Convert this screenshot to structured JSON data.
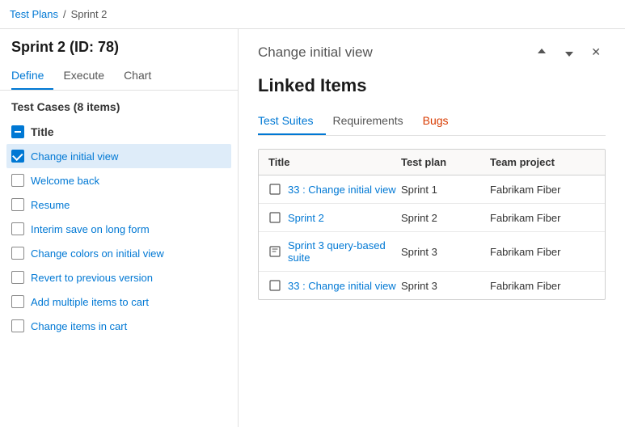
{
  "breadcrumb": {
    "part1": "Test Plans",
    "separator": "/",
    "part2": "Sprint 2"
  },
  "left": {
    "sprint_title": "Sprint 2 (ID: 78)",
    "tabs": [
      {
        "label": "Define",
        "active": true
      },
      {
        "label": "Execute",
        "active": false
      },
      {
        "label": "Chart",
        "active": false
      }
    ],
    "test_cases_header": "Test Cases (8 items)",
    "items": [
      {
        "text": "Title",
        "type": "header"
      },
      {
        "text": "Change initial view",
        "type": "checked",
        "selected": true
      },
      {
        "text": "Welcome back",
        "type": "unchecked",
        "selected": false
      },
      {
        "text": "Resume",
        "type": "unchecked",
        "selected": false
      },
      {
        "text": "Interim save on long form",
        "type": "unchecked",
        "selected": false
      },
      {
        "text": "Change colors on initial view",
        "type": "unchecked",
        "selected": false
      },
      {
        "text": "Revert to previous version",
        "type": "unchecked",
        "selected": false
      },
      {
        "text": "Add multiple items to cart",
        "type": "unchecked",
        "selected": false
      },
      {
        "text": "Change items in cart",
        "type": "unchecked",
        "selected": false
      }
    ]
  },
  "right": {
    "panel_title": "Change initial view",
    "linked_items_heading": "Linked Items",
    "tabs": [
      {
        "label": "Test Suites",
        "active": true,
        "color": "blue"
      },
      {
        "label": "Requirements",
        "active": false,
        "color": "normal"
      },
      {
        "label": "Bugs",
        "active": false,
        "color": "orange"
      }
    ],
    "table": {
      "columns": [
        "Title",
        "Test plan",
        "Team project"
      ],
      "rows": [
        {
          "icon": "static-suite",
          "title": "33 : Change initial view",
          "test_plan": "Sprint 1",
          "team_project": "Fabrikam Fiber"
        },
        {
          "icon": "static-suite",
          "title": "Sprint 2",
          "test_plan": "Sprint 2",
          "team_project": "Fabrikam Fiber"
        },
        {
          "icon": "query-suite",
          "title": "Sprint 3 query-based suite",
          "test_plan": "Sprint 3",
          "team_project": "Fabrikam Fiber"
        },
        {
          "icon": "static-suite",
          "title": "33 : Change initial view",
          "test_plan": "Sprint 3",
          "team_project": "Fabrikam Fiber"
        }
      ]
    },
    "actions": {
      "up": "↑",
      "down": "↓",
      "close": "✕"
    }
  }
}
